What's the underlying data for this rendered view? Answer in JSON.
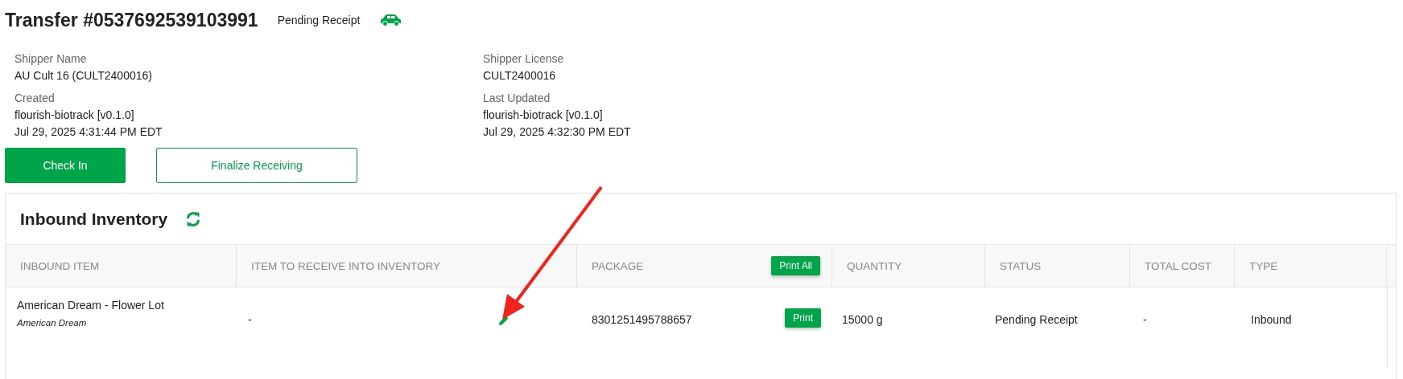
{
  "transfer": {
    "title": "Transfer #0537692539103991",
    "status": "Pending Receipt"
  },
  "details": [
    {
      "label": "Shipper Name",
      "values": [
        "AU Cult 16 (CULT2400016)"
      ]
    },
    {
      "label": "Shipper License",
      "values": [
        "CULT2400016"
      ]
    },
    {
      "label": "Created",
      "values": [
        "flourish-biotrack [v0.1.0]",
        "Jul 29, 2025 4:31:44 PM EDT"
      ]
    },
    {
      "label": "Last Updated",
      "values": [
        "flourish-biotrack [v0.1.0]",
        "Jul 29, 2025 4:32:30 PM EDT"
      ]
    }
  ],
  "actions": [
    {
      "label": "Check In",
      "kind": "primary"
    },
    {
      "label": "Finalize Receiving",
      "kind": "outline"
    }
  ],
  "inventory": {
    "title": "Inbound Inventory",
    "columns": [
      {
        "label": "INBOUND ITEM"
      },
      {
        "label": "ITEM TO RECEIVE INTO INVENTORY"
      },
      {
        "label": "PACKAGE",
        "button": "Print All"
      },
      {
        "label": "QUANTITY"
      },
      {
        "label": "STATUS"
      },
      {
        "label": "TOTAL COST"
      },
      {
        "label": "TYPE"
      }
    ],
    "rows": [
      {
        "item": "American Dream - Flower Lot",
        "strain": "American Dream",
        "receive_into": "-",
        "package": "8301251495788657",
        "print": "Print",
        "quantity": "15000 g",
        "status": "Pending Receipt",
        "total_cost": "-",
        "type": "Inbound"
      }
    ]
  }
}
